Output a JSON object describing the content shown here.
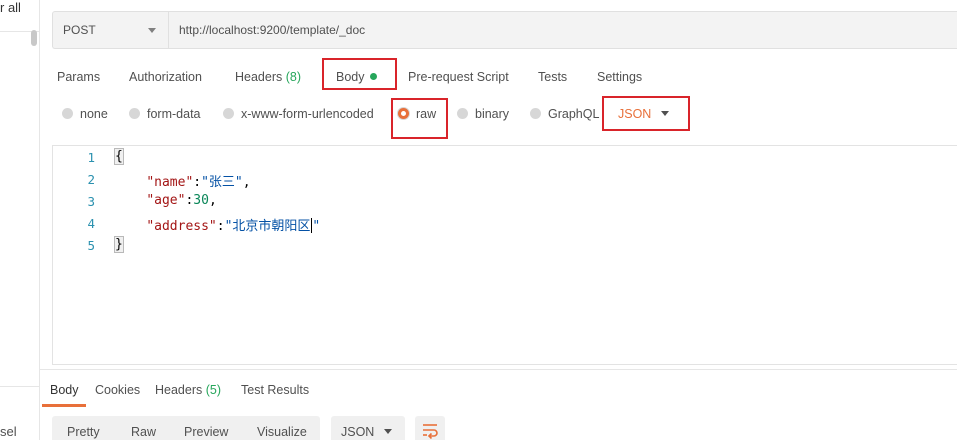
{
  "sidebar": {
    "top_text": "r all",
    "bottom_text": "sel"
  },
  "request": {
    "method": "POST",
    "url": "http://localhost:9200/template/_doc"
  },
  "tabs": {
    "params": "Params",
    "authorization": "Authorization",
    "headers_label": "Headers",
    "headers_count": "(8)",
    "body": "Body",
    "prerequest": "Pre-request Script",
    "tests": "Tests",
    "settings": "Settings"
  },
  "body_modes": {
    "none": "none",
    "form_data": "form-data",
    "urlencoded": "x-www-form-urlencoded",
    "raw": "raw",
    "binary": "binary",
    "graphql": "GraphQL",
    "selected": "raw",
    "format": "JSON"
  },
  "editor": {
    "line_numbers": [
      "1",
      "2",
      "3",
      "4",
      "5"
    ],
    "line1": "{",
    "line2_key": "\"name\"",
    "line2_value": "\"张三\"",
    "line3_key": "\"age\"",
    "line3_value": "30",
    "line4_key": "\"address\"",
    "line4_value_text": "\"北京市朝阳区",
    "line4_value_end": "\"",
    "line5": "}"
  },
  "response": {
    "tabs": {
      "body": "Body",
      "cookies": "Cookies",
      "headers_label": "Headers",
      "headers_count": "(5)",
      "test_results": "Test Results"
    },
    "formats": {
      "pretty": "Pretty",
      "raw": "Raw",
      "preview": "Preview",
      "visualize": "Visualize"
    },
    "language": "JSON"
  },
  "colors": {
    "accent": "#e8703a",
    "success": "#26a65b",
    "highlight_box": "#d9242a"
  },
  "icons": {
    "method_dropdown": "chevron-down-icon",
    "format_dropdown": "chevron-down-icon",
    "wrap": "wrap-lines-icon",
    "body_indicator": "dot-icon"
  }
}
